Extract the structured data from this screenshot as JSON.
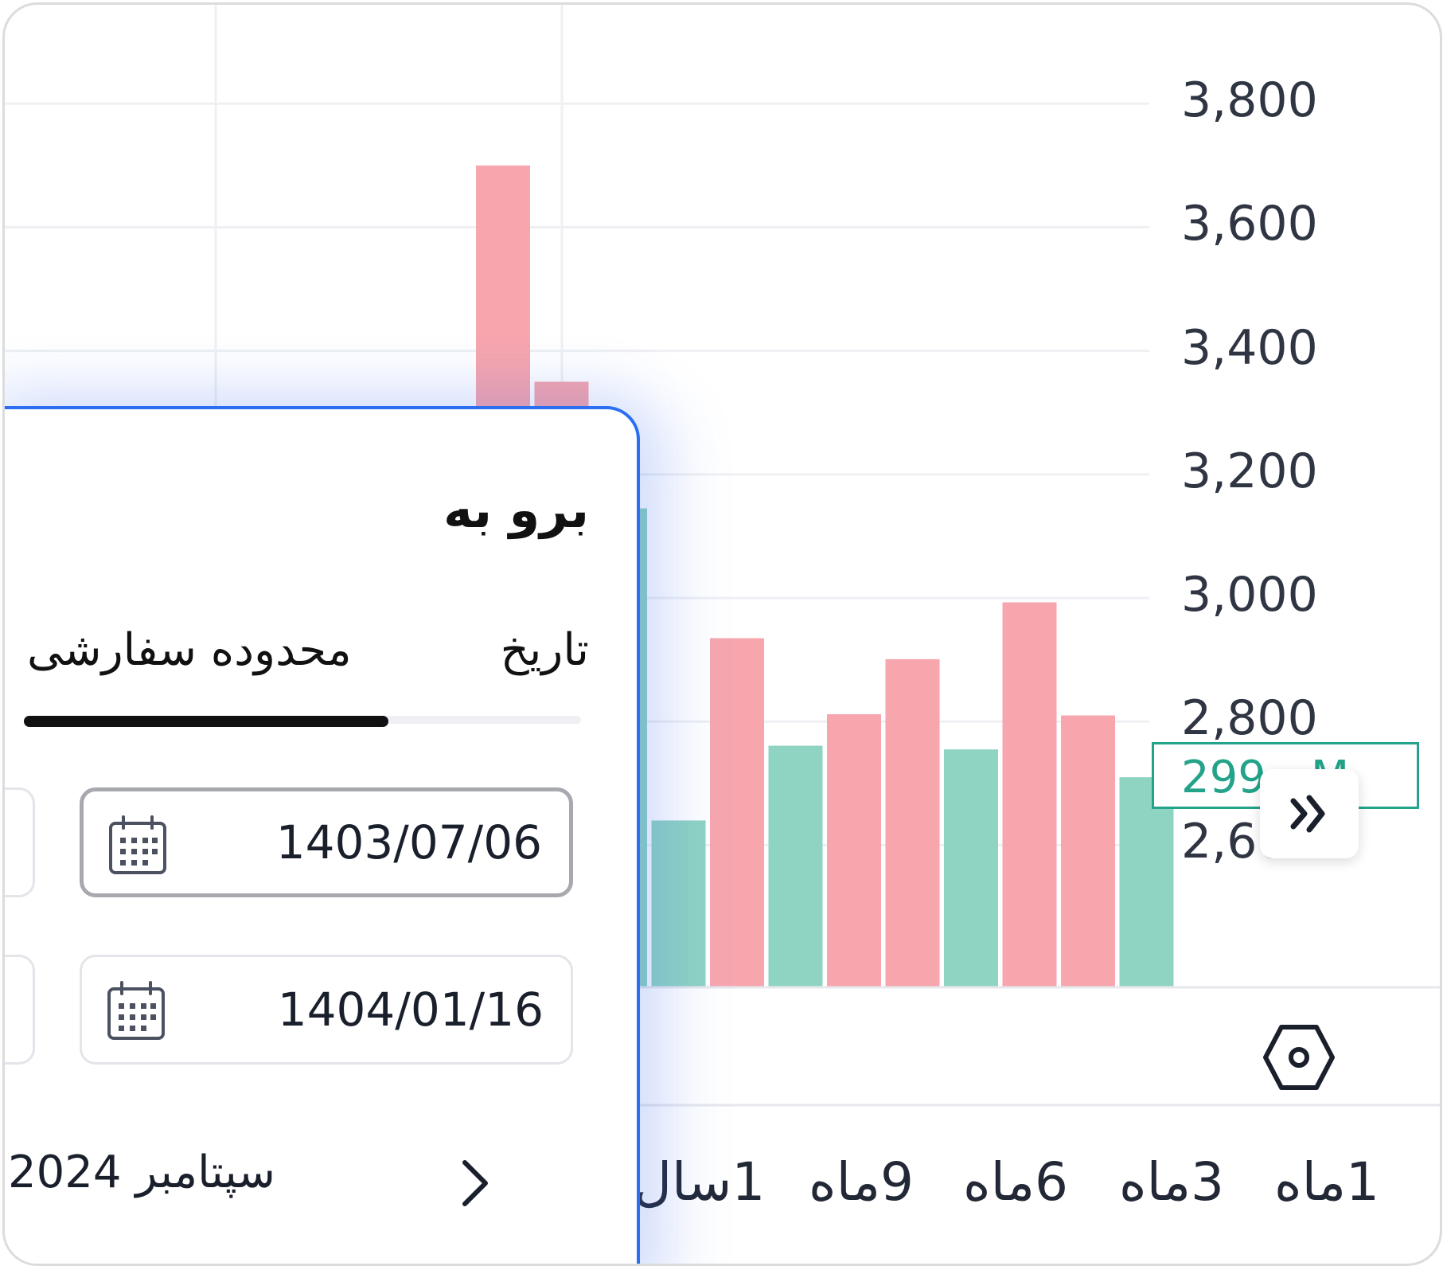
{
  "chart": {
    "price_label": "299…M",
    "colors": {
      "up": "#8fd3c3",
      "down": "#f7a6ae",
      "accent": "#22a38a",
      "popup_border": "#2b6ef2"
    }
  },
  "chart_data": {
    "type": "bar",
    "title": "",
    "xlabel": "",
    "ylabel": "",
    "ylim": [
      2370,
      3960
    ],
    "yticks": [
      "3,800",
      "3,600",
      "3,400",
      "3,200",
      "3,000",
      "2,800",
      "2,600"
    ],
    "ytick_values": [
      3800,
      3600,
      3400,
      3200,
      3000,
      2800,
      2600
    ],
    "bars": [
      {
        "value": 3700,
        "color": "down"
      },
      {
        "value": 3350,
        "color": "down"
      },
      {
        "value": 3145,
        "color": "up"
      },
      {
        "value": 2640,
        "color": "up"
      },
      {
        "value": 2935,
        "color": "down"
      },
      {
        "value": 2761,
        "color": "up"
      },
      {
        "value": 2812,
        "color": "down"
      },
      {
        "value": 2901,
        "color": "down"
      },
      {
        "value": 2755,
        "color": "up"
      },
      {
        "value": 2993,
        "color": "down"
      },
      {
        "value": 2810,
        "color": "down"
      },
      {
        "value": 2710,
        "color": "up"
      }
    ]
  },
  "periods": [
    "1ماه",
    "3ماه",
    "6ماه",
    "9ماه",
    "1سال"
  ],
  "goto_dialog": {
    "title": "برو به",
    "tabs": [
      "تاریخ",
      "محدوده سفارشی"
    ],
    "active_tab": "محدوده سفارشی",
    "start_date": "1403/07/06",
    "end_date": "1404/01/16",
    "month_label": "سپتامبر 2024",
    "icons": {
      "calendar": "calendar-icon",
      "next": "chevron-right-icon"
    }
  }
}
